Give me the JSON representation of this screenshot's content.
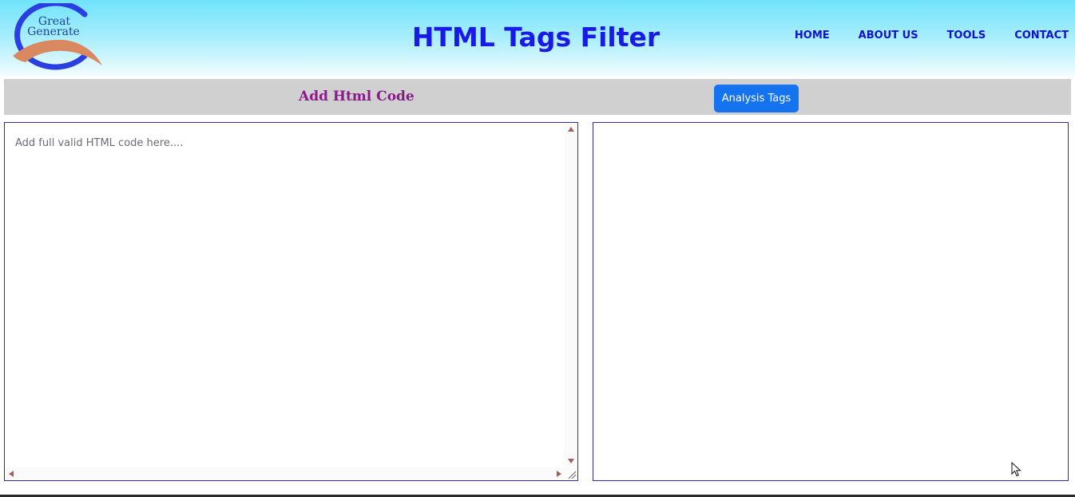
{
  "header": {
    "logo": {
      "line1": "Great",
      "line2": "Generate"
    },
    "title": "HTML Tags Filter",
    "nav": [
      "HOME",
      "ABOUT US",
      "TOOLS",
      "CONTACT"
    ]
  },
  "toolbar": {
    "label": "Add Html Code",
    "analyze_button": "Analysis Tags"
  },
  "editor": {
    "placeholder": "Add full valid HTML code here...."
  },
  "output": {
    "content": ""
  },
  "colors": {
    "title": "#1a1ae6",
    "nav": "#1212c8",
    "toolbar_label": "#8a1a8a",
    "button": "#1573f0",
    "toolbar_bg": "#d0d0d0",
    "box_border": "#2e2e9e"
  }
}
